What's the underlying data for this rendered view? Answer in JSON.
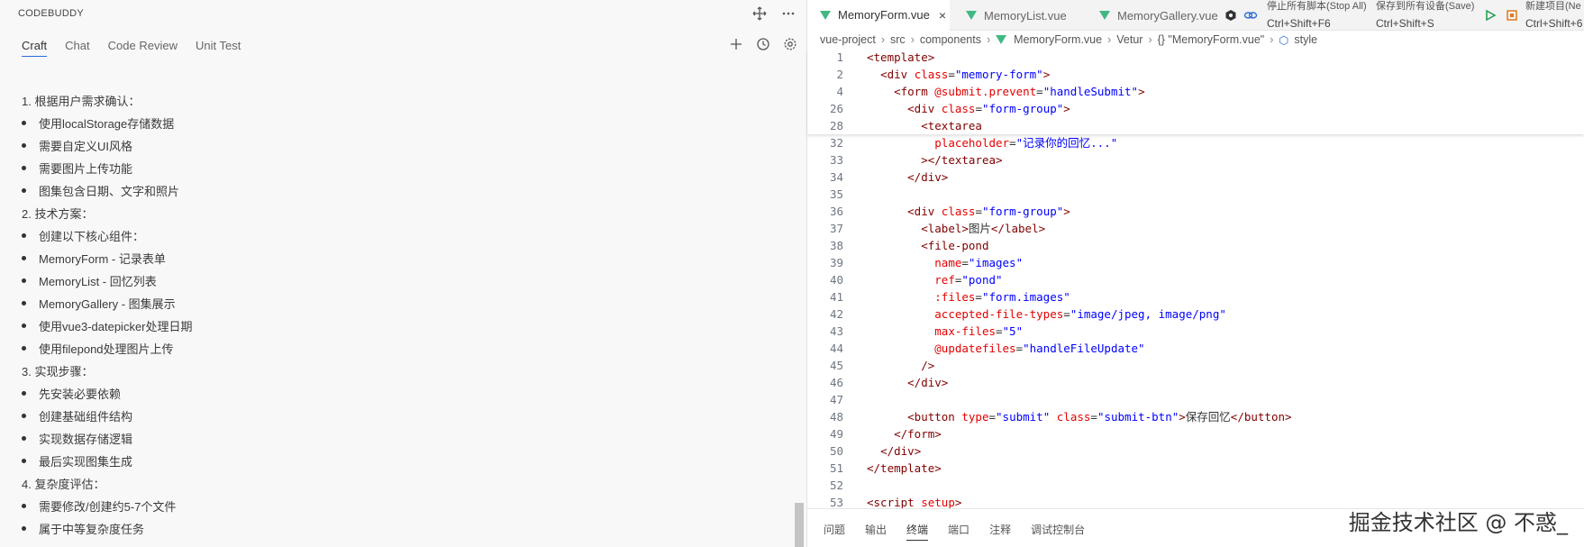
{
  "left_panel": {
    "title": "CODEBUDDY",
    "tabs": [
      {
        "label": "Craft",
        "active": true
      },
      {
        "label": "Chat",
        "active": false
      },
      {
        "label": "Code Review",
        "active": false
      },
      {
        "label": "Unit Test",
        "active": false
      }
    ],
    "content": [
      {
        "type": "numbered",
        "text": "1. 根据用户需求确认："
      },
      {
        "type": "bullet",
        "text": "使用localStorage存储数据"
      },
      {
        "type": "bullet",
        "text": "需要自定义UI风格"
      },
      {
        "type": "bullet",
        "text": "需要图片上传功能"
      },
      {
        "type": "bullet",
        "text": "图集包含日期、文字和照片"
      },
      {
        "type": "numbered",
        "text": "2. 技术方案："
      },
      {
        "type": "bullet",
        "text": "创建以下核心组件："
      },
      {
        "type": "bullet",
        "text": "MemoryForm - 记录表单"
      },
      {
        "type": "bullet",
        "text": "MemoryList - 回忆列表"
      },
      {
        "type": "bullet",
        "text": "MemoryGallery - 图集展示"
      },
      {
        "type": "bullet",
        "text": "使用vue3-datepicker处理日期"
      },
      {
        "type": "bullet",
        "text": "使用filepond处理图片上传"
      },
      {
        "type": "numbered",
        "text": "3. 实现步骤："
      },
      {
        "type": "bullet",
        "text": "先安装必要依赖"
      },
      {
        "type": "bullet",
        "text": "创建基础组件结构"
      },
      {
        "type": "bullet",
        "text": "实现数据存储逻辑"
      },
      {
        "type": "bullet",
        "text": "最后实现图集生成"
      },
      {
        "type": "numbered",
        "text": "4. 复杂度评估："
      },
      {
        "type": "bullet",
        "text": "需要修改/创建约5-7个文件"
      },
      {
        "type": "bullet",
        "text": "属于中等复杂度任务"
      }
    ]
  },
  "editor": {
    "tabs": [
      {
        "label": "MemoryForm.vue",
        "active": true,
        "close": "×"
      },
      {
        "label": "MemoryList.vue",
        "active": false
      },
      {
        "label": "MemoryGallery.vue",
        "active": false
      }
    ],
    "actions": {
      "stop_all_label": "停止所有脚本(Stop All)",
      "stop_all_shortcut": "Ctrl+Shift+F6",
      "save_all_label": "保存到所有设备(Save)",
      "save_all_shortcut": "Ctrl+Shift+S",
      "new_project_label": "新建项目(Ne",
      "new_project_shortcut": "Ctrl+Shift+6"
    },
    "breadcrumb": [
      "vue-project",
      "src",
      "components",
      "MemoryForm.vue",
      "Vetur",
      "{} \"MemoryForm.vue\"",
      "style"
    ],
    "sticky_lines": [
      {
        "n": "1",
        "html": "<span class='tok-tag'>&lt;template&gt;</span>"
      },
      {
        "n": "2",
        "html": "  <span class='tok-tag'>&lt;div</span> <span class='tok-attr'>class</span>=<span class='tok-str'>\"memory-form\"</span><span class='tok-tag'>&gt;</span>"
      },
      {
        "n": "4",
        "html": "    <span class='tok-tag'>&lt;form</span> <span class='tok-attr'>@submit.prevent</span>=<span class='tok-str'>\"handleSubmit\"</span><span class='tok-tag'>&gt;</span>"
      },
      {
        "n": "26",
        "html": "      <span class='tok-tag'>&lt;div</span> <span class='tok-attr'>class</span>=<span class='tok-str'>\"form-group\"</span><span class='tok-tag'>&gt;</span>"
      },
      {
        "n": "28",
        "html": "        <span class='tok-tag'>&lt;textarea</span>"
      }
    ],
    "lines": [
      {
        "n": "32",
        "html": "          <span class='tok-attr'>placeholder</span>=<span class='tok-str'>\"记录你的回忆...\"</span>"
      },
      {
        "n": "33",
        "html": "        <span class='tok-tag'>&gt;&lt;/textarea&gt;</span>"
      },
      {
        "n": "34",
        "html": "      <span class='tok-tag'>&lt;/div&gt;</span>"
      },
      {
        "n": "35",
        "html": ""
      },
      {
        "n": "36",
        "html": "      <span class='tok-tag'>&lt;div</span> <span class='tok-attr'>class</span>=<span class='tok-str'>\"form-group\"</span><span class='tok-tag'>&gt;</span>"
      },
      {
        "n": "37",
        "html": "        <span class='tok-tag'>&lt;label&gt;</span>图片<span class='tok-tag'>&lt;/label&gt;</span>"
      },
      {
        "n": "38",
        "html": "        <span class='tok-tag'>&lt;file-pond</span>"
      },
      {
        "n": "39",
        "html": "          <span class='tok-attr'>name</span>=<span class='tok-str'>\"images\"</span>"
      },
      {
        "n": "40",
        "html": "          <span class='tok-attr'>ref</span>=<span class='tok-str'>\"pond\"</span>"
      },
      {
        "n": "41",
        "html": "          <span class='tok-attr'>:files</span>=<span class='tok-str'>\"form.images\"</span>"
      },
      {
        "n": "42",
        "html": "          <span class='tok-attr'>accepted-file-types</span>=<span class='tok-str'>\"image/jpeg, image/png\"</span>"
      },
      {
        "n": "43",
        "html": "          <span class='tok-attr'>max-files</span>=<span class='tok-str'>\"5\"</span>"
      },
      {
        "n": "44",
        "html": "          <span class='tok-attr'>@updatefiles</span>=<span class='tok-str'>\"handleFileUpdate\"</span>"
      },
      {
        "n": "45",
        "html": "        <span class='tok-tag'>/&gt;</span>"
      },
      {
        "n": "46",
        "html": "      <span class='tok-tag'>&lt;/div&gt;</span>"
      },
      {
        "n": "47",
        "html": ""
      },
      {
        "n": "48",
        "html": "      <span class='tok-tag'>&lt;button</span> <span class='tok-attr'>type</span>=<span class='tok-str'>\"submit\"</span> <span class='tok-attr'>class</span>=<span class='tok-str'>\"submit-btn\"</span><span class='tok-tag'>&gt;</span>保存回忆<span class='tok-tag'>&lt;/button&gt;</span>"
      },
      {
        "n": "49",
        "html": "    <span class='tok-tag'>&lt;/form&gt;</span>"
      },
      {
        "n": "50",
        "html": "  <span class='tok-tag'>&lt;/div&gt;</span>"
      },
      {
        "n": "51",
        "html": "<span class='tok-tag'>&lt;/template&gt;</span>"
      },
      {
        "n": "52",
        "html": ""
      },
      {
        "n": "53",
        "html": "<span class='tok-tag'>&lt;script</span> <span class='tok-attr'>setup</span><span class='tok-tag'>&gt;</span>"
      }
    ],
    "bottom_tabs": [
      {
        "label": "问题",
        "active": false
      },
      {
        "label": "输出",
        "active": false
      },
      {
        "label": "终端",
        "active": true
      },
      {
        "label": "端口",
        "active": false
      },
      {
        "label": "注释",
        "active": false
      },
      {
        "label": "调试控制台",
        "active": false
      }
    ]
  },
  "watermark": "掘金技术社区 @ 不惑_",
  "colors": {
    "vue_green": "#41b883",
    "tag": "#800000",
    "attr": "#e50000",
    "string": "#0000ff",
    "accent": "#2b6bd6"
  }
}
